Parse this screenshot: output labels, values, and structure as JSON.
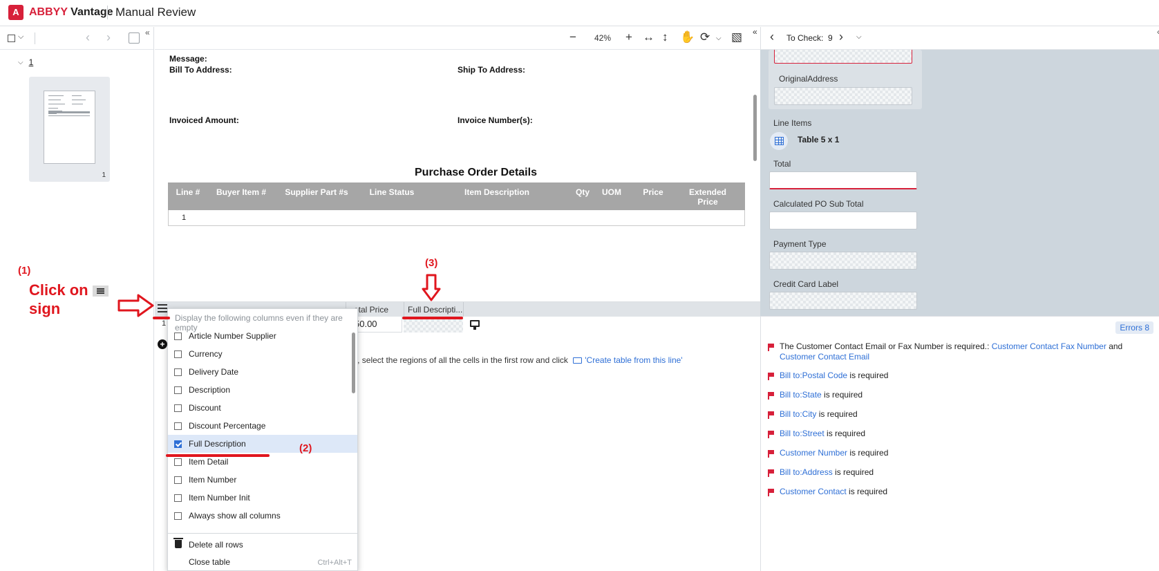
{
  "header": {
    "brand_mark": "A",
    "brand_abbyy": "ABBYY",
    "brand_vantage": "Vantage",
    "title": "Manual Review"
  },
  "left_panel": {
    "page_group": "1",
    "thumbnail_number": "1"
  },
  "viewer": {
    "zoom": "42%",
    "labels": {
      "message": "Message:",
      "bill_to": "Bill To Address:",
      "ship_to": "Ship To Address:",
      "invoiced_amount": "Invoiced Amount:",
      "invoice_numbers": "Invoice Number(s):"
    },
    "heading": "Purchase Order Details",
    "table_headers": [
      "Line #",
      "Buyer Item #",
      "Supplier Part #s",
      "Line Status",
      "Item Description",
      "Qty",
      "UOM",
      "Price",
      "Extended Price"
    ],
    "table_rows": [
      [
        "1"
      ]
    ]
  },
  "right_panel": {
    "to_check_label": "To Check:",
    "to_check_count": "9",
    "fields": {
      "original_address": "OriginalAddress",
      "line_items": "Line Items",
      "table_info": "Table 5 x 1",
      "total": "Total",
      "calc_po_subtotal": "Calculated PO Sub Total",
      "payment_type": "Payment Type",
      "credit_card_label": "Credit Card Label"
    }
  },
  "grid": {
    "col_total_price": "otal Price",
    "col_full_desc": "Full Descripti...",
    "row_num": "1",
    "row_value": "50.00",
    "hint_text": "ally, select the regions of all the cells in the first row and click",
    "hint_link": "'Create table from this line'"
  },
  "menu": {
    "title": "Display the following columns even if they are empty",
    "items": [
      {
        "label": "Article Number Supplier",
        "checked": false
      },
      {
        "label": "Currency",
        "checked": false
      },
      {
        "label": "Delivery Date",
        "checked": false
      },
      {
        "label": "Description",
        "checked": false
      },
      {
        "label": "Discount",
        "checked": false
      },
      {
        "label": "Discount Percentage",
        "checked": false
      },
      {
        "label": "Full Description",
        "checked": true
      },
      {
        "label": "Item Detail",
        "checked": false
      },
      {
        "label": "Item Number",
        "checked": false
      },
      {
        "label": "Item Number Init",
        "checked": false
      },
      {
        "label": "Always show all columns",
        "checked": false
      }
    ],
    "delete_rows": "Delete all rows",
    "close_table": "Close table",
    "close_shortcut": "Ctrl+Alt+T"
  },
  "errors": {
    "badge": "Errors 8",
    "e1_text": "The Customer Contact Email or Fax Number is required.:",
    "e1_link1": "Customer Contact Fax Number",
    "e1_and": "and",
    "e1_link2": "Customer Contact Email",
    "items": [
      {
        "link": "Bill to:Postal Code",
        "text": "is required"
      },
      {
        "link": "Bill to:State",
        "text": "is required"
      },
      {
        "link": "Bill to:City",
        "text": "is required"
      },
      {
        "link": "Bill to:Street",
        "text": "is required"
      },
      {
        "link": "Customer Number",
        "text": "is required"
      },
      {
        "link": "Bill to:Address",
        "text": "is required"
      },
      {
        "link": "Customer Contact",
        "text": "is required"
      }
    ]
  },
  "annotations": {
    "step1": "(1)",
    "click_on": "Click on",
    "sign": "sign",
    "step2": "(2)",
    "step3": "(3)"
  },
  "colors": {
    "accent": "#2e6fd6",
    "brand": "#d7203a",
    "annotation": "#e0161e"
  }
}
